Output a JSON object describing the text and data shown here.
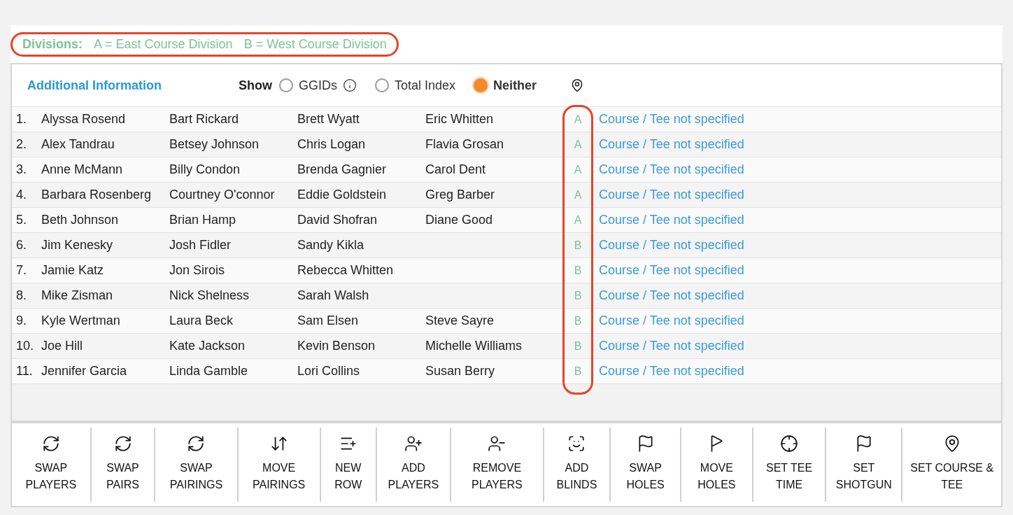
{
  "divisions": {
    "label": "Divisions:",
    "items": [
      "A = East Course Division",
      "B = West Course Division"
    ]
  },
  "additional_info": {
    "title": "Additional Information",
    "show_label": "Show",
    "options": [
      {
        "label": "GGIDs",
        "selected": false,
        "kind": "info"
      },
      {
        "label": "Total Index",
        "selected": false,
        "kind": "plain"
      },
      {
        "label": "Neither",
        "selected": true,
        "kind": "plain"
      }
    ]
  },
  "rows": [
    {
      "number": "1.",
      "players": [
        "Alyssa Rosend",
        "Bart Rickard",
        "Brett Wyatt",
        "Eric Whitten"
      ],
      "division": "A",
      "course": "Course / Tee not specified"
    },
    {
      "number": "2.",
      "players": [
        "Alex Tandrau",
        "Betsey Johnson",
        "Chris Logan",
        "Flavia Grosan"
      ],
      "division": "A",
      "course": "Course / Tee not specified"
    },
    {
      "number": "3.",
      "players": [
        "Anne McMann",
        "Billy Condon",
        "Brenda Gagnier",
        "Carol Dent"
      ],
      "division": "A",
      "course": "Course / Tee not specified"
    },
    {
      "number": "4.",
      "players": [
        "Barbara Rosenberg",
        "Courtney O'connor",
        "Eddie Goldstein",
        "Greg Barber"
      ],
      "division": "A",
      "course": "Course / Tee not specified"
    },
    {
      "number": "5.",
      "players": [
        "Beth Johnson",
        "Brian Hamp",
        "David Shofran",
        "Diane Good"
      ],
      "division": "A",
      "course": "Course / Tee not specified"
    },
    {
      "number": "6.",
      "players": [
        "Jim Kenesky",
        "Josh Fidler",
        "Sandy Kikla"
      ],
      "division": "B",
      "course": "Course / Tee not specified"
    },
    {
      "number": "7.",
      "players": [
        "Jamie Katz",
        "Jon Sirois",
        "Rebecca Whitten"
      ],
      "division": "B",
      "course": "Course / Tee not specified"
    },
    {
      "number": "8.",
      "players": [
        "Mike Zisman",
        "Nick Shelness",
        "Sarah Walsh"
      ],
      "division": "B",
      "course": "Course / Tee not specified"
    },
    {
      "number": "9.",
      "players": [
        "Kyle Wertman",
        "Laura Beck",
        "Sam Elsen",
        "Steve Sayre"
      ],
      "division": "B",
      "course": "Course / Tee not specified"
    },
    {
      "number": "10.",
      "players": [
        "Joe Hill",
        "Kate Jackson",
        "Kevin Benson",
        "Michelle Williams"
      ],
      "division": "B",
      "course": "Course / Tee not specified"
    },
    {
      "number": "11.",
      "players": [
        "Jennifer Garcia",
        "Linda Gamble",
        "Lori Collins",
        "Susan Berry"
      ],
      "division": "B",
      "course": "Course / Tee not specified"
    }
  ],
  "toolbar": [
    {
      "kind": "swap-players",
      "label": "SWAP PLAYERS"
    },
    {
      "kind": "swap-pairs",
      "label": "SWAP PAIRS"
    },
    {
      "kind": "swap-pairings",
      "label": "SWAP PAIRINGS"
    },
    {
      "kind": "move-pairings",
      "label": "MOVE PAIRINGS"
    },
    {
      "kind": "new-row",
      "label": "NEW ROW"
    },
    {
      "kind": "add-players",
      "label": "ADD PLAYERS"
    },
    {
      "kind": "remove-players",
      "label": "REMOVE PLAYERS"
    },
    {
      "kind": "add-blinds",
      "label": "ADD BLINDS"
    },
    {
      "kind": "swap-holes",
      "label": "SWAP HOLES"
    },
    {
      "kind": "move-holes",
      "label": "MOVE HOLES"
    },
    {
      "kind": "tee-time",
      "label": "SET TEE TIME"
    },
    {
      "kind": "shotgun",
      "label": "SET SHOTGUN"
    },
    {
      "kind": "course",
      "label": "SET COURSE & TEE"
    }
  ]
}
